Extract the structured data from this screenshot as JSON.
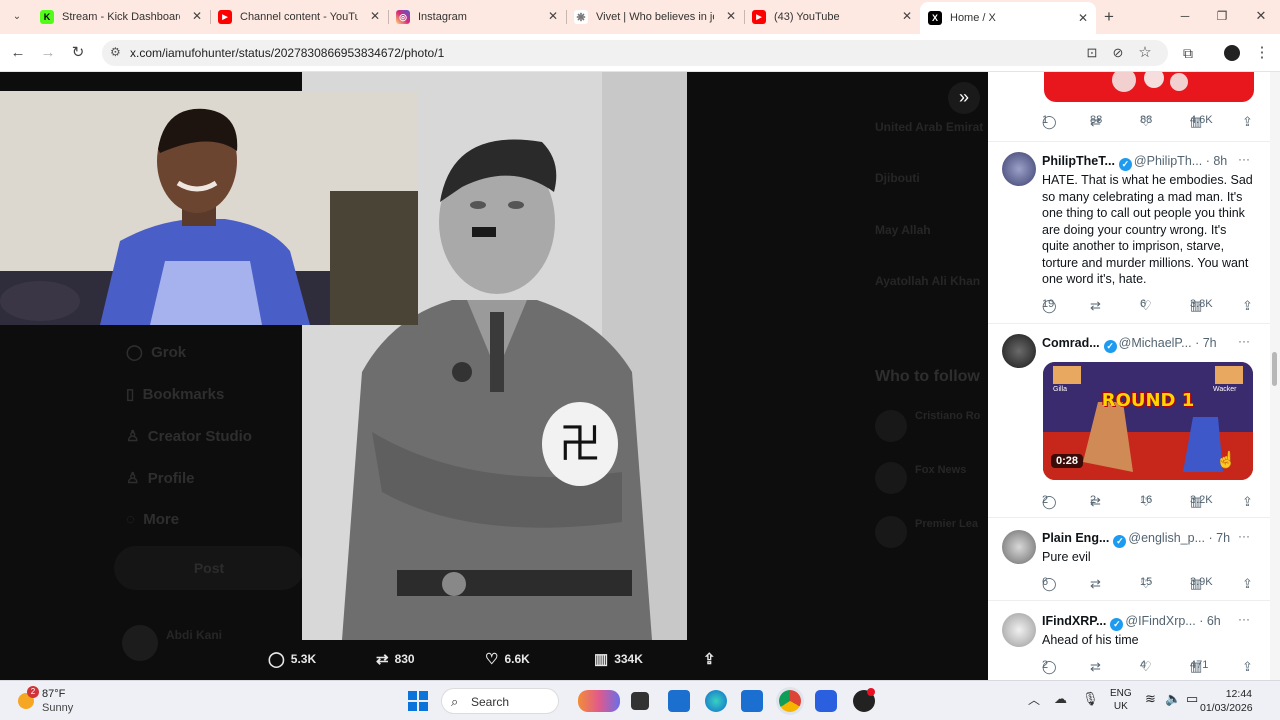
{
  "browser": {
    "tabs": [
      {
        "title": "Stream - Kick Dashboard",
        "favicon": "kick-icon",
        "color": "#53fc18",
        "glyph": "K",
        "active": false
      },
      {
        "title": "Channel content - YouTube",
        "favicon": "youtube-icon",
        "color": "#ff0000",
        "glyph": "▶",
        "active": false
      },
      {
        "title": "Instagram",
        "favicon": "instagram-icon",
        "color": "#d62976",
        "glyph": "◎",
        "active": false
      },
      {
        "title": "Vivet | Who believes in jou",
        "favicon": "vivet-icon",
        "color": "#888888",
        "glyph": "❋",
        "active": false
      },
      {
        "title": "(43) YouTube",
        "favicon": "youtube-icon",
        "color": "#ff0000",
        "glyph": "▶",
        "active": false
      },
      {
        "title": "Home / X",
        "favicon": "x-icon",
        "color": "#000000",
        "glyph": "X",
        "active": true
      }
    ],
    "url": "x.com/iamufohunter/status/2027830866953834672/photo/1"
  },
  "post": {
    "stats": {
      "replies": "5.3K",
      "reposts": "830",
      "likes": "6.6K",
      "views": "334K"
    }
  },
  "background": {
    "nav_items": [
      "Grok",
      "Bookmarks",
      "Creator Studio",
      "Profile",
      "More"
    ],
    "post_button": "Post",
    "account_name": "Abdi Kani",
    "trend_items": [
      "United Arab Emirat",
      "Djibouti",
      "May Allah",
      "Ayatollah Ali Khan"
    ],
    "who_to_follow": "Who to follow",
    "follow_names": [
      "Cristiano Ro",
      "Fox News",
      "Premier Lea"
    ]
  },
  "replies": [
    {
      "name": "",
      "handle": "",
      "time": "",
      "text": "",
      "stats": {
        "replies": "1",
        "reposts": "88",
        "likes": "88",
        "views": "4.6K"
      }
    },
    {
      "name": "PhilipTheT...",
      "handle": "@PhilipTh...",
      "time": "· 8h",
      "text": "HATE. That is what he embodies. Sad so many celebrating a mad man. It's one thing to call out people you think are doing your country wrong. It's quite another to imprison, starve, torture and murder millions. You want one word it's, hate.",
      "stats": {
        "replies": "19",
        "reposts": "",
        "likes": "6",
        "views": "3.8K"
      }
    },
    {
      "name": "Comrad...",
      "handle": "@MichaelP...",
      "time": "· 7h",
      "text": "",
      "video": {
        "banner": "ROUND 1",
        "duration": "0:28",
        "p1": "Gilla",
        "p2": "Wacker"
      },
      "stats": {
        "replies": "2",
        "reposts": "2",
        "likes": "16",
        "views": "3.2K"
      }
    },
    {
      "name": "Plain Eng...",
      "handle": "@english_p...",
      "time": "· 7h",
      "text": "Pure evil",
      "stats": {
        "replies": "6",
        "reposts": "",
        "likes": "15",
        "views": "3.9K"
      }
    },
    {
      "name": "IFindXRP...",
      "handle": "@IFindXrp...",
      "time": "· 6h",
      "text": "Ahead of his time",
      "stats": {
        "replies": "2",
        "reposts": "",
        "likes": "4",
        "views": "471"
      }
    }
  ],
  "taskbar": {
    "weather_temp": "87°F",
    "weather_desc": "Sunny",
    "weather_badge": "2",
    "search_placeholder": "Search",
    "lang": "ENG",
    "region": "UK",
    "time": "12:44",
    "date": "01/03/2026"
  },
  "colors": {
    "accent": "#1d9bf0",
    "tabbar": "#fde9e1",
    "x_bg": "#000000"
  }
}
